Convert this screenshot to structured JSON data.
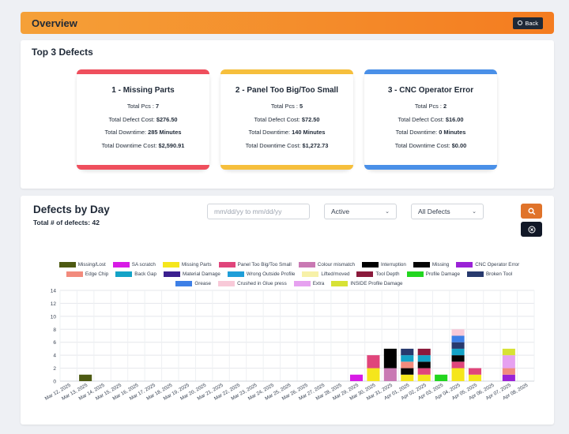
{
  "header": {
    "title": "Overview",
    "back_label": "Back",
    "back_icon": "circle-plus-icon"
  },
  "top_defects": {
    "title": "Top 3 Defects",
    "cards": [
      {
        "title": "1 - Missing Parts",
        "color": "#ef4f5d",
        "total_pcs": "7",
        "total_defect_cost": "$276.50",
        "total_downtime": "285 Minutes",
        "total_downtime_cost": "$2,590.91"
      },
      {
        "title": "2 - Panel Too Big/Too Small",
        "color": "#f6bf3c",
        "total_pcs": "5",
        "total_defect_cost": "$72.50",
        "total_downtime": "140 Minutes",
        "total_downtime_cost": "$1,272.73"
      },
      {
        "title": "3 - CNC Operator Error",
        "color": "#4a90e8",
        "total_pcs": "2",
        "total_defect_cost": "$16.00",
        "total_downtime": "0 Minutes",
        "total_downtime_cost": "$0.00"
      }
    ],
    "labels": {
      "pcs": "Total Pcs :",
      "defect_cost": "Total Defect Cost:",
      "downtime": "Total Downtime:",
      "downtime_cost": "Total Downtime Cost:"
    }
  },
  "defects_by_day": {
    "title": "Defects by Day",
    "total_label": "Total # of defects: 42",
    "date_placeholder": "mm/dd/yy to mm/dd/yy",
    "status_select": "Active",
    "defect_select": "All Defects",
    "search_icon": "magnifier-icon",
    "clear_icon": "circle-x-icon"
  },
  "chart_data": {
    "type": "bar",
    "stacked": true,
    "ylim": [
      0,
      14
    ],
    "yticks": [
      0,
      2,
      4,
      6,
      8,
      10,
      12,
      14
    ],
    "grid": true,
    "legend_position": "top",
    "categories": [
      "Mar 12, 2025",
      "Mar 13, 2025",
      "Mar 14, 2025",
      "Mar 15, 2025",
      "Mar 16, 2025",
      "Mar 17, 2025",
      "Mar 18, 2025",
      "Mar 19, 2025",
      "Mar 20, 2025",
      "Mar 21, 2025",
      "Mar 22, 2025",
      "Mar 23, 2025",
      "Mar 24, 2025",
      "Mar 25, 2025",
      "Mar 26, 2025",
      "Mar 27, 2025",
      "Mar 28, 2025",
      "Mar 29, 2025",
      "Mar 30, 2025",
      "Mar 31, 2025",
      "Apr 01, 2025",
      "Apr 02, 2025",
      "Apr 03, 2025",
      "Apr 04, 2025",
      "Apr 05, 2025",
      "Apr 06, 2025",
      "Apr 07, 2025",
      "Apr 08, 2025"
    ],
    "series": [
      {
        "name": "Missing/Lost",
        "color": "#4d5a12",
        "values": [
          0,
          1,
          0,
          0,
          0,
          0,
          0,
          0,
          0,
          0,
          0,
          0,
          0,
          0,
          0,
          0,
          0,
          0,
          0,
          0,
          0,
          0,
          0,
          0,
          0,
          0,
          0,
          0
        ]
      },
      {
        "name": "SA scratch",
        "color": "#d81be6",
        "values": [
          0,
          0,
          0,
          0,
          0,
          0,
          0,
          0,
          0,
          0,
          0,
          0,
          0,
          0,
          0,
          0,
          0,
          1,
          0,
          0,
          0,
          0,
          0,
          0,
          0,
          0,
          0,
          0
        ]
      },
      {
        "name": "Missing Parts",
        "color": "#f5e61c",
        "values": [
          0,
          0,
          0,
          0,
          0,
          0,
          0,
          0,
          0,
          0,
          0,
          0,
          0,
          0,
          0,
          0,
          0,
          0,
          2,
          0,
          1,
          1,
          0,
          2,
          1,
          0,
          0,
          0
        ]
      },
      {
        "name": "Panel Too Big/Too Small",
        "color": "#e0457b",
        "values": [
          0,
          0,
          0,
          0,
          0,
          0,
          0,
          0,
          0,
          0,
          0,
          0,
          0,
          0,
          0,
          0,
          0,
          0,
          2,
          0,
          0,
          1,
          0,
          1,
          1,
          0,
          0,
          0
        ]
      },
      {
        "name": "Colour mismatch",
        "color": "#c979b3",
        "values": [
          0,
          0,
          0,
          0,
          0,
          0,
          0,
          0,
          0,
          0,
          0,
          0,
          0,
          0,
          0,
          0,
          0,
          0,
          0,
          2,
          0,
          0,
          0,
          0,
          0,
          0,
          0,
          0
        ]
      },
      {
        "name": "Interruption",
        "color": "#000000",
        "values": [
          0,
          0,
          0,
          0,
          0,
          0,
          0,
          0,
          0,
          0,
          0,
          0,
          0,
          0,
          0,
          0,
          0,
          0,
          0,
          3,
          0,
          0,
          0,
          0,
          0,
          0,
          0,
          0
        ]
      },
      {
        "name": "Missing",
        "color": "#050505",
        "values": [
          0,
          0,
          0,
          0,
          0,
          0,
          0,
          0,
          0,
          0,
          0,
          0,
          0,
          0,
          0,
          0,
          0,
          0,
          0,
          0,
          1,
          1,
          0,
          1,
          0,
          0,
          0,
          0
        ]
      },
      {
        "name": "CNC Operator Error",
        "color": "#9a22d6",
        "values": [
          0,
          0,
          0,
          0,
          0,
          0,
          0,
          0,
          0,
          0,
          0,
          0,
          0,
          0,
          0,
          0,
          0,
          0,
          0,
          0,
          0,
          0,
          0,
          0,
          0,
          0,
          1,
          0
        ]
      },
      {
        "name": "Edge Chip",
        "color": "#f28b7d",
        "values": [
          0,
          0,
          0,
          0,
          0,
          0,
          0,
          0,
          0,
          0,
          0,
          0,
          0,
          0,
          0,
          0,
          0,
          0,
          0,
          0,
          1,
          0,
          0,
          0,
          0,
          0,
          1,
          0
        ]
      },
      {
        "name": "Back Gap",
        "color": "#14a3c7",
        "values": [
          0,
          0,
          0,
          0,
          0,
          0,
          0,
          0,
          0,
          0,
          0,
          0,
          0,
          0,
          0,
          0,
          0,
          0,
          0,
          0,
          1,
          1,
          0,
          1,
          0,
          0,
          0,
          0
        ]
      },
      {
        "name": "Material Damage",
        "color": "#3b1f8f",
        "values": [
          0,
          0,
          0,
          0,
          0,
          0,
          0,
          0,
          0,
          0,
          0,
          0,
          0,
          0,
          0,
          0,
          0,
          0,
          0,
          0,
          0,
          0,
          0,
          0,
          0,
          0,
          0,
          0
        ]
      },
      {
        "name": "Wrong Outside Profile",
        "color": "#1f9ed8",
        "values": [
          0,
          0,
          0,
          0,
          0,
          0,
          0,
          0,
          0,
          0,
          0,
          0,
          0,
          0,
          0,
          0,
          0,
          0,
          0,
          0,
          0,
          0,
          0,
          0,
          0,
          0,
          0,
          0
        ]
      },
      {
        "name": "Lifted/moved",
        "color": "#f7f1a8",
        "values": [
          0,
          0,
          0,
          0,
          0,
          0,
          0,
          0,
          0,
          0,
          0,
          0,
          0,
          0,
          0,
          0,
          0,
          0,
          0,
          0,
          0,
          0,
          0,
          0,
          0,
          0,
          0,
          0
        ]
      },
      {
        "name": "Tool Depth",
        "color": "#8b1a3c",
        "values": [
          0,
          0,
          0,
          0,
          0,
          0,
          0,
          0,
          0,
          0,
          0,
          0,
          0,
          0,
          0,
          0,
          0,
          0,
          0,
          0,
          0,
          1,
          0,
          0,
          0,
          0,
          0,
          0
        ]
      },
      {
        "name": "Profile Damage",
        "color": "#22d61f",
        "values": [
          0,
          0,
          0,
          0,
          0,
          0,
          0,
          0,
          0,
          0,
          0,
          0,
          0,
          0,
          0,
          0,
          0,
          0,
          0,
          0,
          0,
          0,
          1,
          0,
          0,
          0,
          0,
          0
        ]
      },
      {
        "name": "Broken Tool",
        "color": "#283a6e",
        "values": [
          0,
          0,
          0,
          0,
          0,
          0,
          0,
          0,
          0,
          0,
          0,
          0,
          0,
          0,
          0,
          0,
          0,
          0,
          0,
          0,
          1,
          0,
          0,
          1,
          0,
          0,
          0,
          0
        ]
      },
      {
        "name": "Grease",
        "color": "#3d7fe6",
        "values": [
          0,
          0,
          0,
          0,
          0,
          0,
          0,
          0,
          0,
          0,
          0,
          0,
          0,
          0,
          0,
          0,
          0,
          0,
          0,
          0,
          0,
          0,
          0,
          1,
          0,
          0,
          0,
          0
        ]
      },
      {
        "name": "Crushed in Glue press",
        "color": "#f8c9d8",
        "values": [
          0,
          0,
          0,
          0,
          0,
          0,
          0,
          0,
          0,
          0,
          0,
          0,
          0,
          0,
          0,
          0,
          0,
          0,
          0,
          0,
          0,
          0,
          0,
          1,
          0,
          0,
          0,
          0
        ]
      },
      {
        "name": "Extra",
        "color": "#e6a1f0",
        "values": [
          0,
          0,
          0,
          0,
          0,
          0,
          0,
          0,
          0,
          0,
          0,
          0,
          0,
          0,
          0,
          0,
          0,
          0,
          0,
          0,
          0,
          0,
          0,
          0,
          0,
          0,
          2,
          0
        ]
      },
      {
        "name": "INSIDE Profile Damage",
        "color": "#d7e235",
        "values": [
          0,
          0,
          0,
          0,
          0,
          0,
          0,
          0,
          0,
          0,
          0,
          0,
          0,
          0,
          0,
          0,
          0,
          0,
          0,
          0,
          0,
          0,
          0,
          0,
          0,
          0,
          1,
          0
        ]
      }
    ]
  }
}
